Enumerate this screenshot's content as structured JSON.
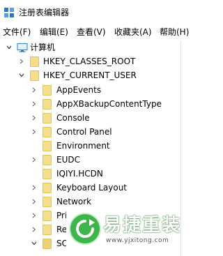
{
  "window": {
    "title": "注册表编辑器",
    "icon": "registry-editor-icon"
  },
  "menu": {
    "file": "文件(F)",
    "edit": "编辑(E)",
    "view": "查看(V)",
    "favorites": "收藏夹(A)",
    "help": "帮助(H)"
  },
  "tree": {
    "root_label": "计算机",
    "classes_root": "HKEY_CLASSES_ROOT",
    "current_user": "HKEY_CURRENT_USER",
    "children": [
      "AppEvents",
      "AppXBackupContentType",
      "Console",
      "Control Panel",
      "Environment",
      "EUDC",
      "IQIYI.HCDN",
      "Keyboard Layout",
      "Network",
      "Printers",
      "Remote",
      "SOFTWARE"
    ]
  },
  "watermark": {
    "brand": "易捷重装",
    "url": "www.yjxitong.com"
  },
  "colors": {
    "folder_fill": "#f6dd87",
    "watermark_green": "#3db54a"
  }
}
